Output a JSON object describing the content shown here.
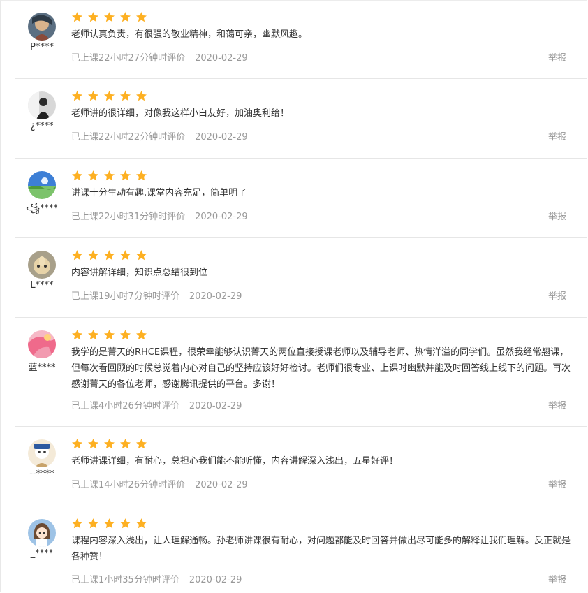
{
  "colors": {
    "star": "#FDB022",
    "meta": "#999999",
    "text": "#333333",
    "divider": "#e6e6e6"
  },
  "reviews": [
    {
      "username": "P****",
      "rating": 5,
      "content": "老师认真负责，有很强的敬业精神，和蔼可亲，幽默风趣。",
      "duration": "已上课22小时27分钟时评价",
      "date": "2020-02-29",
      "report": "举报",
      "avatar_icon": "avatar-portrait-icon"
    },
    {
      "username": "¿****",
      "rating": 5,
      "content": "老师讲的很详细，对像我这样小白友好，加油奥利给！",
      "duration": "已上课22小时22分钟时评价",
      "date": "2020-02-29",
      "report": "举报",
      "avatar_icon": "avatar-silhouette-icon"
    },
    {
      "username": "꧁****",
      "rating": 5,
      "content": "讲课十分生动有趣,课堂内容充足，简单明了",
      "duration": "已上课22小时31分钟时评价",
      "date": "2020-02-29",
      "report": "举报",
      "avatar_icon": "avatar-landscape-icon"
    },
    {
      "username": "L****",
      "rating": 5,
      "content": "内容讲解详细，知识点总结很到位",
      "duration": "已上课19小时7分钟时评价",
      "date": "2020-02-29",
      "report": "举报",
      "avatar_icon": "avatar-thumbs-up-icon"
    },
    {
      "username": "蓝****",
      "rating": 5,
      "content": "我学的是菁天的RHCE课程，很荣幸能够认识菁天的两位直接授课老师以及辅导老师、热情洋溢的同学们。虽然我经常翘课，但每次看回顾的时候总觉着内心对自己的坚持应该好好检讨。老师们很专业、上课时幽默并能及时回答线上线下的问题。再次感谢菁天的各位老师，感谢腾讯提供的平台。多谢！",
      "duration": "已上课4小时26分钟时评价",
      "date": "2020-02-29",
      "report": "举报",
      "avatar_icon": "avatar-pink-icon"
    },
    {
      "username": "--****",
      "rating": 5,
      "content": "老师讲课详细，有耐心，总担心我们能不能听懂，内容讲解深入浅出，五星好评！",
      "duration": "已上课14小时26分钟时评价",
      "date": "2020-02-29",
      "report": "举报",
      "avatar_icon": "avatar-cartoon-icon"
    },
    {
      "username": "_****",
      "rating": 5,
      "content": "课程内容深入浅出，让人理解通畅。孙老师讲课很有耐心，对问题都能及时回答并做出尽可能多的解释让我们理解。反正就是各种赞！",
      "duration": "已上课1小时35分钟时评价",
      "date": "2020-02-29",
      "report": "举报",
      "avatar_icon": "avatar-girl-icon"
    }
  ]
}
